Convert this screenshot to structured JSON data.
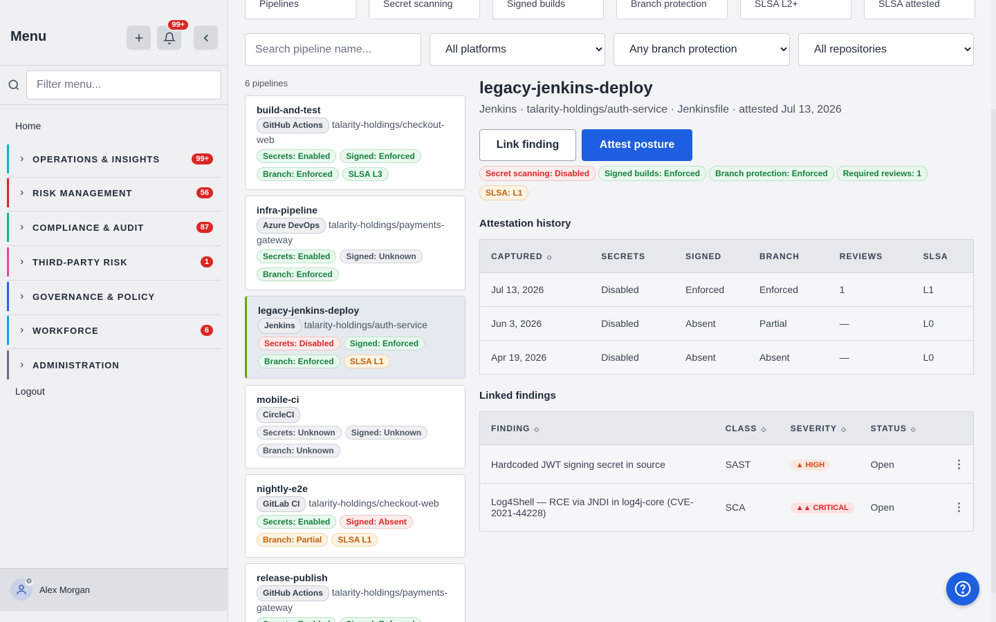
{
  "sidebar": {
    "title": "Menu",
    "notif_count": "99+",
    "filter_placeholder": "Filter menu...",
    "home": "Home",
    "items": [
      {
        "label": "OPERATIONS & INSIGHTS",
        "count": "99+",
        "color": "#06b6d4"
      },
      {
        "label": "RISK MANAGEMENT",
        "count": "56",
        "color": "#dc2626"
      },
      {
        "label": "COMPLIANCE & AUDIT",
        "count": "87",
        "color": "#10b981"
      },
      {
        "label": "THIRD-PARTY RISK",
        "count": "1",
        "color": "#ec4899"
      },
      {
        "label": "GOVERNANCE & POLICY",
        "count": "",
        "color": "#2563eb"
      },
      {
        "label": "WORKFORCE",
        "count": "6",
        "color": "#0ea5e9"
      },
      {
        "label": "ADMINISTRATION",
        "count": "",
        "color": "#6b7280"
      }
    ],
    "logout": "Logout",
    "user": "Alex Morgan"
  },
  "kpis": [
    "Pipelines",
    "Secret scanning",
    "Signed builds",
    "Branch protection",
    "SLSA L2+",
    "SLSA attested"
  ],
  "filters": {
    "search_placeholder": "Search pipeline name...",
    "platform": "All platforms",
    "branch": "Any branch protection",
    "repo": "All repositories"
  },
  "count_label": "6 pipelines",
  "pipelines": [
    {
      "name": "build-and-test",
      "platform": "GitHub Actions",
      "repo": "talarity-holdings/checkout-web",
      "tags": [
        {
          "t": "Secrets: Enabled",
          "c": "green"
        },
        {
          "t": "Signed: Enforced",
          "c": "green"
        },
        {
          "t": "Branch: Enforced",
          "c": "green"
        },
        {
          "t": "SLSA L3",
          "c": "green"
        }
      ]
    },
    {
      "name": "infra-pipeline",
      "platform": "Azure DevOps",
      "repo": "talarity-holdings/payments-gateway",
      "tags": [
        {
          "t": "Secrets: Enabled",
          "c": "green"
        },
        {
          "t": "Signed: Unknown",
          "c": "gray"
        },
        {
          "t": "Branch: Enforced",
          "c": "green"
        }
      ]
    },
    {
      "name": "legacy-jenkins-deploy",
      "platform": "Jenkins",
      "repo": "talarity-holdings/auth-service",
      "tags": [
        {
          "t": "Secrets: Disabled",
          "c": "red"
        },
        {
          "t": "Signed: Enforced",
          "c": "green"
        },
        {
          "t": "Branch: Enforced",
          "c": "green"
        },
        {
          "t": "SLSA L1",
          "c": "amber"
        }
      ]
    },
    {
      "name": "mobile-ci",
      "platform": "CircleCI",
      "repo": "",
      "tags": [
        {
          "t": "Secrets: Unknown",
          "c": "gray"
        },
        {
          "t": "Signed: Unknown",
          "c": "gray"
        },
        {
          "t": "Branch: Unknown",
          "c": "gray"
        }
      ]
    },
    {
      "name": "nightly-e2e",
      "platform": "GitLab CI",
      "repo": "talarity-holdings/checkout-web",
      "tags": [
        {
          "t": "Secrets: Enabled",
          "c": "green"
        },
        {
          "t": "Signed: Absent",
          "c": "red"
        },
        {
          "t": "Branch: Partial",
          "c": "amber"
        },
        {
          "t": "SLSA L1",
          "c": "amber"
        }
      ]
    },
    {
      "name": "release-publish",
      "platform": "GitHub Actions",
      "repo": "talarity-holdings/payments-gateway",
      "tags": [
        {
          "t": "Secrets: Enabled",
          "c": "green"
        },
        {
          "t": "Signed: Enforced",
          "c": "green"
        }
      ]
    }
  ],
  "detail": {
    "title": "legacy-jenkins-deploy",
    "subtitle": "Jenkins · talarity-holdings/auth-service · Jenkinsfile · attested Jul 13, 2026",
    "link_btn": "Link finding",
    "attest_btn": "Attest posture",
    "posture": [
      {
        "t": "Secret scanning: Disabled",
        "c": "red"
      },
      {
        "t": "Signed builds: Enforced",
        "c": "green"
      },
      {
        "t": "Branch protection: Enforced",
        "c": "green"
      },
      {
        "t": "Required reviews: 1",
        "c": "green"
      },
      {
        "t": "SLSA: L1",
        "c": "amber"
      }
    ],
    "history_title": "Attestation history",
    "history_cols": [
      "CAPTURED",
      "SECRETS",
      "SIGNED",
      "BRANCH",
      "REVIEWS",
      "SLSA"
    ],
    "history_rows": [
      [
        "Jul 13, 2026",
        "Disabled",
        "Enforced",
        "Enforced",
        "1",
        "L1"
      ],
      [
        "Jun 3, 2026",
        "Disabled",
        "Absent",
        "Partial",
        "—",
        "L0"
      ],
      [
        "Apr 19, 2026",
        "Disabled",
        "Absent",
        "Absent",
        "—",
        "L0"
      ]
    ],
    "findings_title": "Linked findings",
    "findings_cols": [
      "FINDING",
      "CLASS",
      "SEVERITY",
      "STATUS"
    ],
    "findings_rows": [
      {
        "finding": "Hardcoded JWT signing secret in source",
        "cls": "SAST",
        "sev": "▲ HIGH",
        "sevType": "high",
        "status": "Open"
      },
      {
        "finding": "Log4Shell — RCE via JNDI in log4j-core (CVE-2021-44228)",
        "cls": "SCA",
        "sev": "▲▲ CRITICAL",
        "sevType": "crit",
        "status": "Open"
      }
    ]
  }
}
